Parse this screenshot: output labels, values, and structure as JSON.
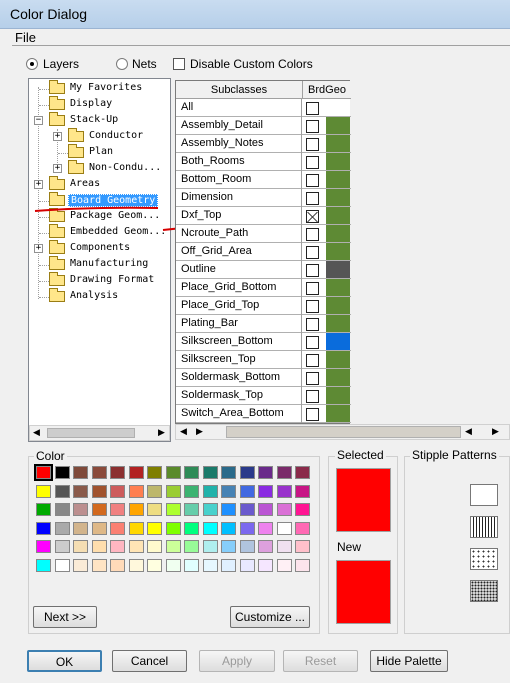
{
  "window": {
    "title": "Color Dialog"
  },
  "menu": {
    "file": "File"
  },
  "options": {
    "layers": "Layers",
    "nets": "Nets",
    "disable_custom_colors": "Disable Custom Colors"
  },
  "tree": [
    {
      "label": "My Favorites"
    },
    {
      "label": "Display"
    },
    {
      "label": "Stack-Up"
    },
    {
      "label": "Conductor"
    },
    {
      "label": "Plan"
    },
    {
      "label": "Non-Condu..."
    },
    {
      "label": "Areas"
    },
    {
      "label": "Board Geometry"
    },
    {
      "label": "Package Geom..."
    },
    {
      "label": "Embedded Geom..."
    },
    {
      "label": "Components"
    },
    {
      "label": "Manufacturing"
    },
    {
      "label": "Drawing Format"
    },
    {
      "label": "Analysis"
    }
  ],
  "grid": {
    "col_subclasses": "Subclasses",
    "col_class": "BrdGeo",
    "rows": [
      {
        "name": "All",
        "checked": false,
        "color": "#ffffff"
      },
      {
        "name": "Assembly_Detail",
        "checked": false,
        "color": "#5e8a34"
      },
      {
        "name": "Assembly_Notes",
        "checked": false,
        "color": "#5e8a34"
      },
      {
        "name": "Both_Rooms",
        "checked": false,
        "color": "#5e8a34"
      },
      {
        "name": "Bottom_Room",
        "checked": false,
        "color": "#5e8a34"
      },
      {
        "name": "Dimension",
        "checked": false,
        "color": "#5e8a34"
      },
      {
        "name": "Dxf_Top",
        "checked": true,
        "color": "#5e8a34"
      },
      {
        "name": "Ncroute_Path",
        "checked": false,
        "color": "#5e8a34"
      },
      {
        "name": "Off_Grid_Area",
        "checked": false,
        "color": "#5e8a34"
      },
      {
        "name": "Outline",
        "checked": false,
        "color": "#555555"
      },
      {
        "name": "Place_Grid_Bottom",
        "checked": false,
        "color": "#5e8a34"
      },
      {
        "name": "Place_Grid_Top",
        "checked": false,
        "color": "#5e8a34"
      },
      {
        "name": "Plating_Bar",
        "checked": false,
        "color": "#5e8a34"
      },
      {
        "name": "Silkscreen_Bottom",
        "checked": false,
        "color": "#0a6cdc"
      },
      {
        "name": "Silkscreen_Top",
        "checked": false,
        "color": "#5e8a34"
      },
      {
        "name": "Soldermask_Bottom",
        "checked": false,
        "color": "#5e8a34"
      },
      {
        "name": "Soldermask_Top",
        "checked": false,
        "color": "#5e8a34"
      },
      {
        "name": "Switch_Area_Bottom",
        "checked": false,
        "color": "#5e8a34"
      }
    ]
  },
  "color_group": {
    "title": "Color"
  },
  "palette": [
    [
      "#ff0000",
      "#000000",
      "#7f4a3a",
      "#8a4a3a",
      "#8b3030",
      "#b22222",
      "#7f7f00",
      "#5a8a2a",
      "#2e8b57",
      "#1a7a6a",
      "#2a6a8a",
      "#2a3a8a",
      "#6a2a8a",
      "#7a2a6a",
      "#8a2a4a"
    ],
    [
      "#ffff00",
      "#555555",
      "#8a5a4a",
      "#a0522d",
      "#cd5c5c",
      "#ff7f50",
      "#bdb76b",
      "#9acd32",
      "#3cb371",
      "#20b2aa",
      "#4682b4",
      "#4169e1",
      "#8a2be2",
      "#9932cc",
      "#c71585"
    ],
    [
      "#00aa00",
      "#888888",
      "#bc8f8f",
      "#d2691e",
      "#f08080",
      "#ffa500",
      "#eedd82",
      "#adff2f",
      "#66cdaa",
      "#48d1cc",
      "#1e90ff",
      "#6a5acd",
      "#ba55d3",
      "#da70d6",
      "#ff1493"
    ],
    [
      "#0000ff",
      "#aaaaaa",
      "#d2b48c",
      "#deb887",
      "#fa8072",
      "#ffd700",
      "#ffff00",
      "#7fff00",
      "#00ff7f",
      "#00ffff",
      "#00bfff",
      "#7b68ee",
      "#ee82ee",
      "#ffffff",
      "#ff69b4"
    ],
    [
      "#ff00ff",
      "#cccccc",
      "#f5deb3",
      "#ffdead",
      "#ffb6c1",
      "#ffe4b5",
      "#fffacd",
      "#ccff99",
      "#98fb98",
      "#afeeee",
      "#87cefa",
      "#b0c4de",
      "#dda0dd",
      "#f0e0f0",
      "#ffc0cb"
    ],
    [
      "#00ffff",
      "#ffffff",
      "#faebd7",
      "#ffe4c4",
      "#ffdab9",
      "#fff8dc",
      "#ffffe0",
      "#f0fff0",
      "#e0ffff",
      "#e6f7ff",
      "#e0f0ff",
      "#e8e8ff",
      "#f5e6ff",
      "#fff0f5",
      "#fce4ec"
    ]
  ],
  "selected": {
    "title": "Selected",
    "color": "#ff0000"
  },
  "new": {
    "title": "New",
    "color": "#ff0000"
  },
  "stipple": {
    "title": "Stipple Patterns"
  },
  "buttons": {
    "next": "Next >>",
    "customize": "Customize ...",
    "ok": "OK",
    "cancel": "Cancel",
    "apply": "Apply",
    "reset": "Reset",
    "hide_palette": "Hide Palette"
  }
}
